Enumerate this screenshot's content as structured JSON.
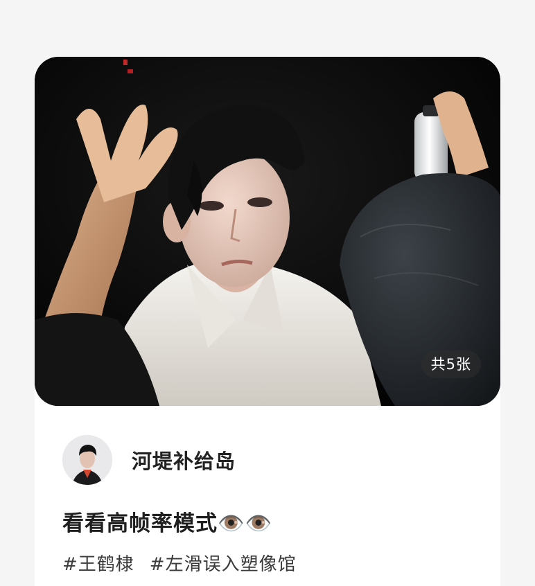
{
  "post": {
    "image_count_badge": "共5张",
    "author_name": "河堤补给岛",
    "title": "看看高帧率模式👁️👁️",
    "tags": [
      "#王鹤棣",
      "#左滑误入塑像馆"
    ]
  },
  "icons": {
    "avatar": "avatar-image"
  },
  "colors": {
    "page_background": "#f5f5f5",
    "card_background": "#ffffff",
    "text_primary": "#1f1f1f"
  }
}
